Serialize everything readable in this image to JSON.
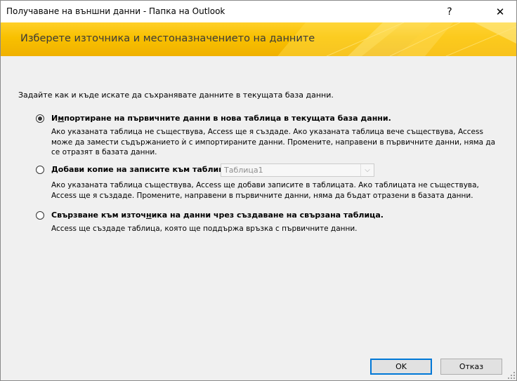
{
  "window": {
    "title": "Получаване на външни данни - Папка на Outlook",
    "help_glyph": "?",
    "close_glyph": "✕"
  },
  "banner": {
    "heading": "Изберете източника и местоназначението на данните",
    "accent_color": "#f8c000"
  },
  "main": {
    "intro": "Задайте как и къде искате да съхранявате данните в текущата база данни.",
    "options": [
      {
        "selected": true,
        "label_first": "И",
        "label_mnemonic": "м",
        "label_rest": "портиране на първичните данни в нова таблица в текущата база данни.",
        "description": "Ако указаната таблица не съществува, Access ще я създаде. Ако указаната таблица вече съществува, Access може да замести съдържанието ѝ с импортираните данни. Промените, направени в първичните данни, няма да се отразят в базата данни."
      },
      {
        "selected": false,
        "label_first": "",
        "label_mnemonic": "Д",
        "label_rest": "обави копие на записите към таблицата:",
        "description": "Ако указаната таблица съществува, Access ще добави записите в таблицата. Ако таблицата не съществува, Access ще я създаде. Промените, направени в първичните данни, няма да бъдат отразени в базата данни."
      },
      {
        "selected": false,
        "label_first": "Свързване към източ",
        "label_mnemonic": "н",
        "label_rest": "ика на данни чрез създаване на свързана таблица.",
        "description": "Access ще създаде таблица, която ще поддържа връзка с първичните данни."
      }
    ],
    "table_combo": {
      "value": "Таблица1",
      "arrow_glyph": "⌵"
    }
  },
  "footer": {
    "ok_label": "OK",
    "cancel_label": "Отказ"
  }
}
